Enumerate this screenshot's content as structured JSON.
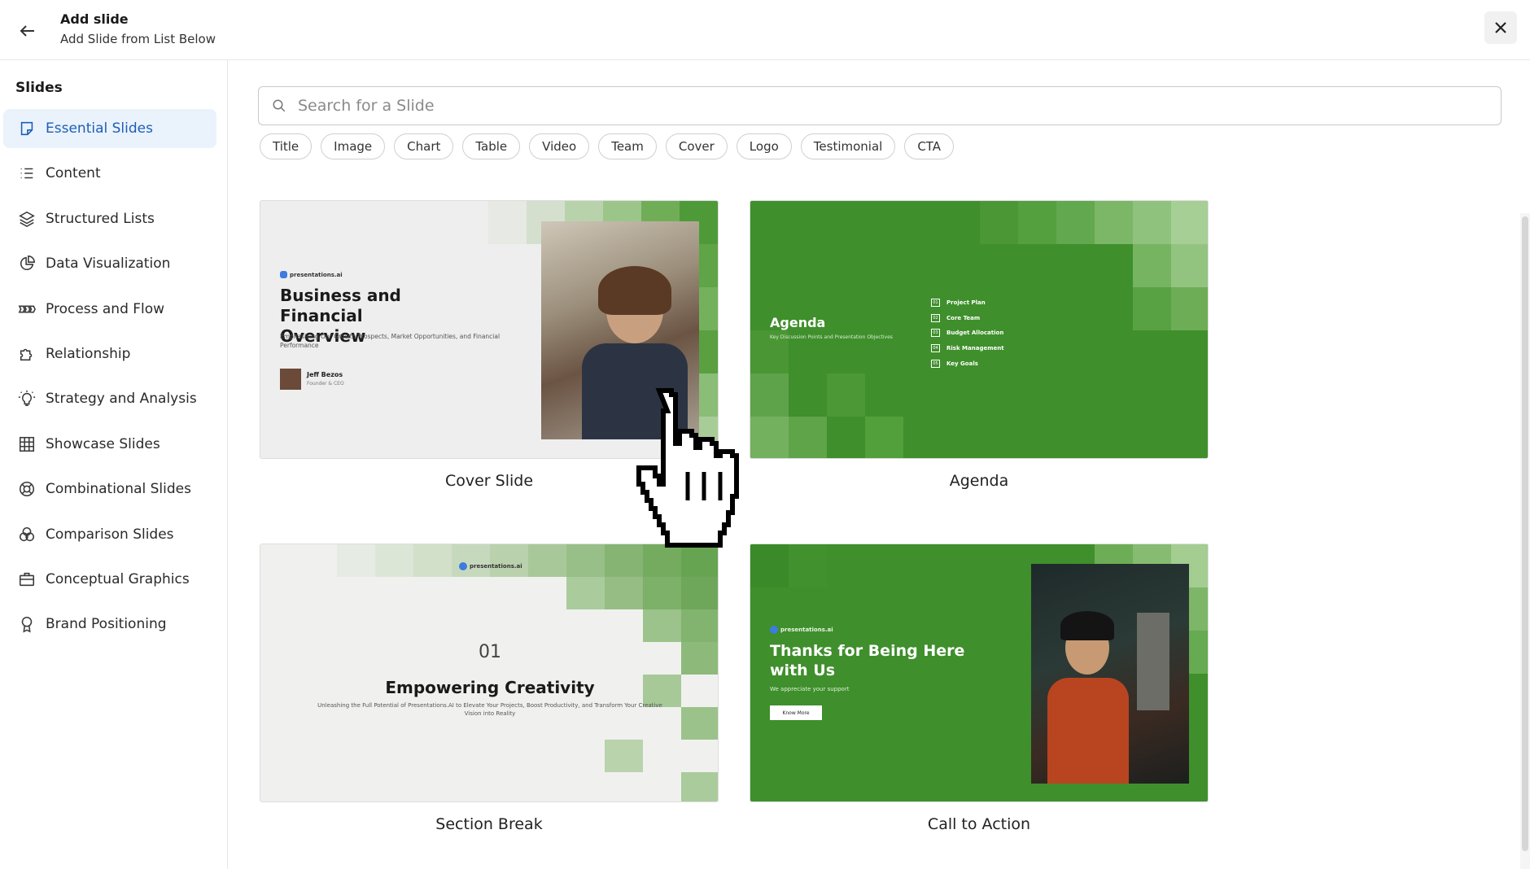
{
  "header": {
    "title": "Add slide",
    "subtitle": "Add Slide from List Below"
  },
  "sidebar": {
    "heading": "Slides",
    "items": [
      {
        "label": "Essential Slides",
        "icon": "note-icon",
        "active": true
      },
      {
        "label": "Content",
        "icon": "list-icon"
      },
      {
        "label": "Structured Lists",
        "icon": "layers-icon"
      },
      {
        "label": "Data Visualization",
        "icon": "pie-chart-icon"
      },
      {
        "label": "Process and Flow",
        "icon": "arrows-flow-icon"
      },
      {
        "label": "Relationship",
        "icon": "puzzle-icon"
      },
      {
        "label": "Strategy and Analysis",
        "icon": "bulb-icon"
      },
      {
        "label": "Showcase Slides",
        "icon": "table-grid-icon"
      },
      {
        "label": "Combinational Slides",
        "icon": "lifebuoy-icon"
      },
      {
        "label": "Comparison Slides",
        "icon": "venn-icon"
      },
      {
        "label": "Conceptual Graphics",
        "icon": "briefcase-icon"
      },
      {
        "label": "Brand Positioning",
        "icon": "badge-icon"
      }
    ]
  },
  "search": {
    "placeholder": "Search for a Slide"
  },
  "filters": [
    "Title",
    "Image",
    "Chart",
    "Table",
    "Video",
    "Team",
    "Cover",
    "Logo",
    "Testimonial",
    "CTA"
  ],
  "cards": [
    {
      "label": "Cover Slide",
      "brand": "presentations.ai",
      "heading": "Business and Financial Overview",
      "desc": "Emphasising Our Growth Prospects, Market Opportunities, and Financial Performance",
      "person_name": "Jeff Bezos",
      "person_role": "Founder & CEO"
    },
    {
      "label": "Agenda",
      "heading": "Agenda",
      "desc": "Key Discussion Points and Presentation Objectives",
      "items": [
        {
          "num": "01",
          "text": "Project Plan"
        },
        {
          "num": "02",
          "text": "Core Team"
        },
        {
          "num": "03",
          "text": "Budget Allocation"
        },
        {
          "num": "04",
          "text": "Risk Management"
        },
        {
          "num": "05",
          "text": "Key Goals"
        }
      ]
    },
    {
      "label": "Section Break",
      "brand": "presentations.ai",
      "number": "01",
      "heading": "Empowering Creativity",
      "desc": "Unleashing the Full Potential of Presentations.AI to Elevate Your Projects, Boost Productivity, and Transform Your Creative Vision into Reality"
    },
    {
      "label": "Call to Action",
      "brand": "presentations.ai",
      "heading": "Thanks for Being Here with Us",
      "desc": "We appreciate your support",
      "button": "Know More"
    }
  ],
  "colors": {
    "accent": "#1d5fb5",
    "active_bg": "#eaf2fc",
    "green": "#3f8f2c"
  }
}
